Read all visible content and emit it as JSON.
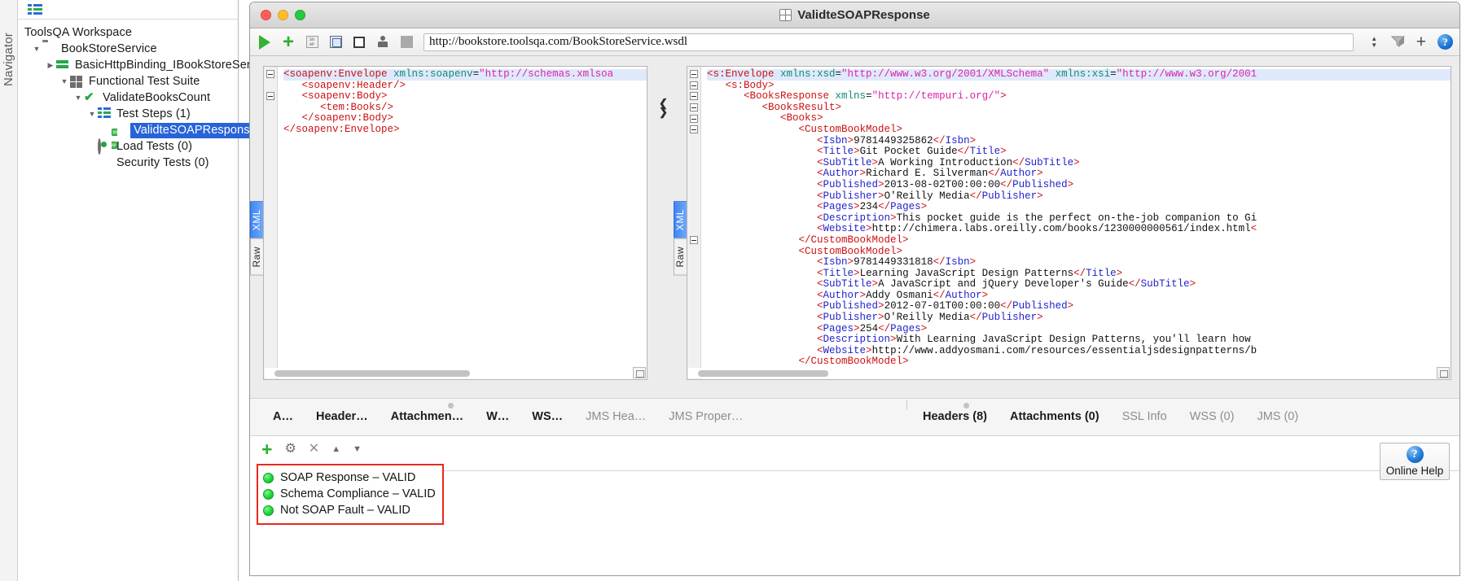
{
  "navigator": {
    "label": "Navigator",
    "toolbar_icon": "list-icon"
  },
  "tree": {
    "root": "ToolsQA Workspace",
    "items": [
      {
        "label": "BookStoreService",
        "icon": "folder-icon",
        "twisty": "down",
        "indent": 1
      },
      {
        "label": "BasicHttpBinding_IBookStoreServi",
        "icon": "interface-arrows-icon",
        "twisty": "right",
        "indent": 2
      },
      {
        "label": "Functional Test Suite",
        "icon": "test-suite-grid-icon",
        "twisty": "down",
        "indent": 2
      },
      {
        "label": "ValidateBooksCount",
        "icon": "green-check-icon",
        "twisty": "down",
        "indent": 3
      },
      {
        "label": "Test Steps (1)",
        "icon": "test-steps-icon",
        "twisty": "down",
        "indent": 4
      },
      {
        "label": "ValidteSOAPResponse",
        "icon": "soap-request-icon",
        "twisty": "blank",
        "indent": 5,
        "selected": true
      },
      {
        "label": "Load Tests (0)",
        "icon": "load-test-icon",
        "twisty": "blank",
        "indent": 4
      },
      {
        "label": "Security Tests (0)",
        "icon": "security-test-shield-icon",
        "twisty": "blank",
        "indent": 4
      }
    ]
  },
  "window": {
    "title": "ValidteSOAPResponse",
    "title_icon": "soap-request-icon",
    "traffic_lights": [
      "close-button",
      "minimize-button",
      "zoom-button"
    ]
  },
  "toolbar": {
    "buttons": [
      {
        "name": "run-button",
        "icon": "play-icon"
      },
      {
        "name": "add-assertion-button",
        "icon": "plus-icon"
      },
      {
        "name": "soap-format-button",
        "icon": "soap-icon"
      },
      {
        "name": "outline-editor-button",
        "icon": "form-editor-icon"
      },
      {
        "name": "overview-button",
        "icon": "square-icon"
      },
      {
        "name": "auth-button",
        "icon": "person-icon"
      },
      {
        "name": "stop-button",
        "icon": "stop-square-icon"
      }
    ],
    "url": "http://bookstore.toolsqa.com/BookStoreService.wsdl",
    "right_buttons": [
      {
        "name": "endpoint-stepper",
        "icon": "stepper-up-down-icon"
      },
      {
        "name": "filter-button",
        "icon": "filter-icon"
      },
      {
        "name": "add-endpoint-button",
        "icon": "plus-icon"
      },
      {
        "name": "help-button",
        "icon": "help-circle-icon",
        "glyph": "?"
      }
    ]
  },
  "request_editor": {
    "view_tabs": [
      {
        "label": "XML",
        "active": true
      },
      {
        "label": "Raw",
        "active": false
      }
    ],
    "lines": [
      [
        {
          "t": "<soapenv:Envelope",
          "c": "tg"
        },
        {
          "t": " xmlns:soapenv",
          "c": "at"
        },
        {
          "t": "=",
          "c": "txt"
        },
        {
          "t": "\"http://schemas.xmlsoa",
          "c": "av"
        }
      ],
      [
        {
          "t": "   <soapenv:Header/>",
          "c": "tg"
        }
      ],
      [
        {
          "t": "   <soapenv:Body>",
          "c": "tg"
        }
      ],
      [
        {
          "t": "      <tem:Books/>",
          "c": "tg"
        }
      ],
      [
        {
          "t": "   </soapenv:Body>",
          "c": "tg"
        }
      ],
      [
        {
          "t": "</soapenv:Envelope>",
          "c": "tg"
        }
      ]
    ]
  },
  "response_editor": {
    "view_tabs": [
      {
        "label": "XML",
        "active": true
      },
      {
        "label": "Raw",
        "active": false
      }
    ],
    "lines": [
      [
        {
          "t": "<s:Envelope",
          "c": "tg"
        },
        {
          "t": " xmlns:xsd",
          "c": "at"
        },
        {
          "t": "=",
          "c": "txt"
        },
        {
          "t": "\"http://www.w3.org/2001/XMLSchema\"",
          "c": "av"
        },
        {
          "t": " xmlns:xsi",
          "c": "at"
        },
        {
          "t": "=",
          "c": "txt"
        },
        {
          "t": "\"http://www.w3.org/2001",
          "c": "av"
        }
      ],
      [
        {
          "t": "   <s:Body>",
          "c": "tg"
        }
      ],
      [
        {
          "t": "      <BooksResponse",
          "c": "tg"
        },
        {
          "t": " xmlns",
          "c": "at"
        },
        {
          "t": "=",
          "c": "txt"
        },
        {
          "t": "\"http://tempuri.org/\"",
          "c": "av"
        },
        {
          "t": ">",
          "c": "tg"
        }
      ],
      [
        {
          "t": "         <BooksResult>",
          "c": "tg"
        }
      ],
      [
        {
          "t": "            <Books>",
          "c": "tg"
        }
      ],
      [
        {
          "t": "               <CustomBookModel>",
          "c": "tg"
        }
      ],
      [
        {
          "t": "                  <",
          "c": "tg"
        },
        {
          "t": "Isbn",
          "c": "tgb"
        },
        {
          "t": ">",
          "c": "tg"
        },
        {
          "t": "9781449325862",
          "c": "txt"
        },
        {
          "t": "</",
          "c": "tg"
        },
        {
          "t": "Isbn",
          "c": "tgb"
        },
        {
          "t": ">",
          "c": "tg"
        }
      ],
      [
        {
          "t": "                  <",
          "c": "tg"
        },
        {
          "t": "Title",
          "c": "tgb"
        },
        {
          "t": ">",
          "c": "tg"
        },
        {
          "t": "Git Pocket Guide",
          "c": "txt"
        },
        {
          "t": "</",
          "c": "tg"
        },
        {
          "t": "Title",
          "c": "tgb"
        },
        {
          "t": ">",
          "c": "tg"
        }
      ],
      [
        {
          "t": "                  <",
          "c": "tg"
        },
        {
          "t": "SubTitle",
          "c": "tgb"
        },
        {
          "t": ">",
          "c": "tg"
        },
        {
          "t": "A Working Introduction",
          "c": "txt"
        },
        {
          "t": "</",
          "c": "tg"
        },
        {
          "t": "SubTitle",
          "c": "tgb"
        },
        {
          "t": ">",
          "c": "tg"
        }
      ],
      [
        {
          "t": "                  <",
          "c": "tg"
        },
        {
          "t": "Author",
          "c": "tgb"
        },
        {
          "t": ">",
          "c": "tg"
        },
        {
          "t": "Richard E. Silverman",
          "c": "txt"
        },
        {
          "t": "</",
          "c": "tg"
        },
        {
          "t": "Author",
          "c": "tgb"
        },
        {
          "t": ">",
          "c": "tg"
        }
      ],
      [
        {
          "t": "                  <",
          "c": "tg"
        },
        {
          "t": "Published",
          "c": "tgb"
        },
        {
          "t": ">",
          "c": "tg"
        },
        {
          "t": "2013-08-02T00:00:00",
          "c": "txt"
        },
        {
          "t": "</",
          "c": "tg"
        },
        {
          "t": "Published",
          "c": "tgb"
        },
        {
          "t": ">",
          "c": "tg"
        }
      ],
      [
        {
          "t": "                  <",
          "c": "tg"
        },
        {
          "t": "Publisher",
          "c": "tgb"
        },
        {
          "t": ">",
          "c": "tg"
        },
        {
          "t": "O'Reilly Media",
          "c": "txt"
        },
        {
          "t": "</",
          "c": "tg"
        },
        {
          "t": "Publisher",
          "c": "tgb"
        },
        {
          "t": ">",
          "c": "tg"
        }
      ],
      [
        {
          "t": "                  <",
          "c": "tg"
        },
        {
          "t": "Pages",
          "c": "tgb"
        },
        {
          "t": ">",
          "c": "tg"
        },
        {
          "t": "234",
          "c": "txt"
        },
        {
          "t": "</",
          "c": "tg"
        },
        {
          "t": "Pages",
          "c": "tgb"
        },
        {
          "t": ">",
          "c": "tg"
        }
      ],
      [
        {
          "t": "                  <",
          "c": "tg"
        },
        {
          "t": "Description",
          "c": "tgb"
        },
        {
          "t": ">",
          "c": "tg"
        },
        {
          "t": "This pocket guide is the perfect on-the-job companion to Gi",
          "c": "txt"
        }
      ],
      [
        {
          "t": "                  <",
          "c": "tg"
        },
        {
          "t": "Website",
          "c": "tgb"
        },
        {
          "t": ">",
          "c": "tg"
        },
        {
          "t": "http://chimera.labs.oreilly.com/books/1230000000561/index.html",
          "c": "txt"
        },
        {
          "t": "<",
          "c": "tg"
        }
      ],
      [
        {
          "t": "               </CustomBookModel>",
          "c": "tg"
        }
      ],
      [
        {
          "t": "               <CustomBookModel>",
          "c": "tg"
        }
      ],
      [
        {
          "t": "                  <",
          "c": "tg"
        },
        {
          "t": "Isbn",
          "c": "tgb"
        },
        {
          "t": ">",
          "c": "tg"
        },
        {
          "t": "9781449331818",
          "c": "txt"
        },
        {
          "t": "</",
          "c": "tg"
        },
        {
          "t": "Isbn",
          "c": "tgb"
        },
        {
          "t": ">",
          "c": "tg"
        }
      ],
      [
        {
          "t": "                  <",
          "c": "tg"
        },
        {
          "t": "Title",
          "c": "tgb"
        },
        {
          "t": ">",
          "c": "tg"
        },
        {
          "t": "Learning JavaScript Design Patterns",
          "c": "txt"
        },
        {
          "t": "</",
          "c": "tg"
        },
        {
          "t": "Title",
          "c": "tgb"
        },
        {
          "t": ">",
          "c": "tg"
        }
      ],
      [
        {
          "t": "                  <",
          "c": "tg"
        },
        {
          "t": "SubTitle",
          "c": "tgb"
        },
        {
          "t": ">",
          "c": "tg"
        },
        {
          "t": "A JavaScript and jQuery Developer's Guide",
          "c": "txt"
        },
        {
          "t": "</",
          "c": "tg"
        },
        {
          "t": "SubTitle",
          "c": "tgb"
        },
        {
          "t": ">",
          "c": "tg"
        }
      ],
      [
        {
          "t": "                  <",
          "c": "tg"
        },
        {
          "t": "Author",
          "c": "tgb"
        },
        {
          "t": ">",
          "c": "tg"
        },
        {
          "t": "Addy Osmani",
          "c": "txt"
        },
        {
          "t": "</",
          "c": "tg"
        },
        {
          "t": "Author",
          "c": "tgb"
        },
        {
          "t": ">",
          "c": "tg"
        }
      ],
      [
        {
          "t": "                  <",
          "c": "tg"
        },
        {
          "t": "Published",
          "c": "tgb"
        },
        {
          "t": ">",
          "c": "tg"
        },
        {
          "t": "2012-07-01T00:00:00",
          "c": "txt"
        },
        {
          "t": "</",
          "c": "tg"
        },
        {
          "t": "Published",
          "c": "tgb"
        },
        {
          "t": ">",
          "c": "tg"
        }
      ],
      [
        {
          "t": "                  <",
          "c": "tg"
        },
        {
          "t": "Publisher",
          "c": "tgb"
        },
        {
          "t": ">",
          "c": "tg"
        },
        {
          "t": "O'Reilly Media",
          "c": "txt"
        },
        {
          "t": "</",
          "c": "tg"
        },
        {
          "t": "Publisher",
          "c": "tgb"
        },
        {
          "t": ">",
          "c": "tg"
        }
      ],
      [
        {
          "t": "                  <",
          "c": "tg"
        },
        {
          "t": "Pages",
          "c": "tgb"
        },
        {
          "t": ">",
          "c": "tg"
        },
        {
          "t": "254",
          "c": "txt"
        },
        {
          "t": "</",
          "c": "tg"
        },
        {
          "t": "Pages",
          "c": "tgb"
        },
        {
          "t": ">",
          "c": "tg"
        }
      ],
      [
        {
          "t": "                  <",
          "c": "tg"
        },
        {
          "t": "Description",
          "c": "tgb"
        },
        {
          "t": ">",
          "c": "tg"
        },
        {
          "t": "With Learning JavaScript Design Patterns, you'll learn how",
          "c": "txt"
        }
      ],
      [
        {
          "t": "                  <",
          "c": "tg"
        },
        {
          "t": "Website",
          "c": "tgb"
        },
        {
          "t": ">",
          "c": "tg"
        },
        {
          "t": "http://www.addyosmani.com/resources/essentialjsdesignpatterns/b",
          "c": "txt"
        }
      ],
      [
        {
          "t": "               </CustomBookModel>",
          "c": "tg"
        }
      ]
    ]
  },
  "request_tabs": [
    {
      "label": "A…",
      "active": true
    },
    {
      "label": "Header…",
      "active": true
    },
    {
      "label": "Attachmen…",
      "active": true
    },
    {
      "label": "W…",
      "active": true
    },
    {
      "label": "WS…",
      "active": true
    },
    {
      "label": "JMS Hea…",
      "active": false
    },
    {
      "label": "JMS Proper…",
      "active": false
    }
  ],
  "response_tabs": [
    {
      "label": "Headers (8)",
      "active": true
    },
    {
      "label": "Attachments (0)",
      "active": true
    },
    {
      "label": "SSL Info",
      "active": false
    },
    {
      "label": "WSS (0)",
      "active": false
    },
    {
      "label": "JMS (0)",
      "active": false
    }
  ],
  "assertions": {
    "toolbar": [
      {
        "name": "add-assertion-button",
        "icon": "plus-icon",
        "glyph": "＋"
      },
      {
        "name": "configure-assertion-button",
        "icon": "gear-icon",
        "glyph": "⚙"
      },
      {
        "name": "remove-assertion-button",
        "icon": "close-icon",
        "glyph": "✕"
      },
      {
        "name": "move-assertion-up-button",
        "icon": "chevron-up-icon",
        "glyph": "▲"
      },
      {
        "name": "move-assertion-down-button",
        "icon": "chevron-down-icon",
        "glyph": "▼"
      }
    ],
    "highlight_color": "#e8291c",
    "items": [
      {
        "label": "SOAP Response – VALID",
        "status": "valid",
        "status_color": "#22d63a"
      },
      {
        "label": "Schema Compliance – VALID",
        "status": "valid",
        "status_color": "#22d63a"
      },
      {
        "label": "Not SOAP Fault – VALID",
        "status": "valid",
        "status_color": "#22d63a"
      }
    ]
  },
  "online_help": {
    "label": "Online Help",
    "icon": "help-circle-icon",
    "glyph": "?"
  }
}
